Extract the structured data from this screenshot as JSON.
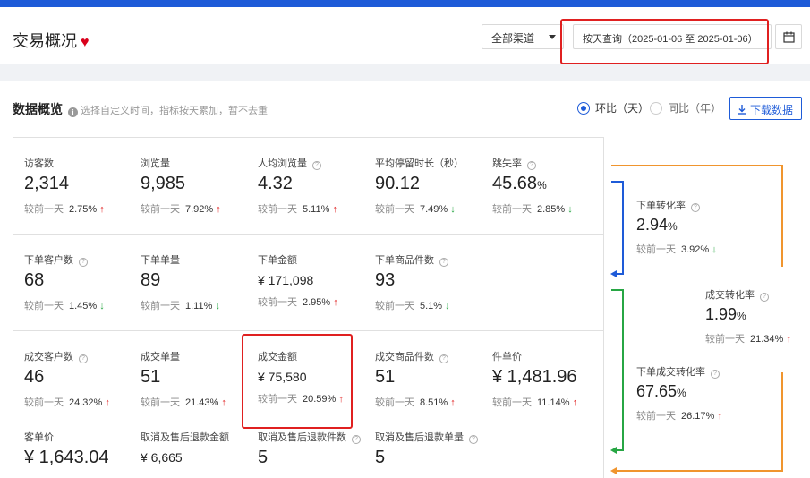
{
  "header": {
    "title": "交易概况",
    "channel": "全部渠道",
    "date_range": "按天查询（2025-01-06 至 2025-01-06）"
  },
  "overview": {
    "title": "数据概览",
    "hint": "选择自定义时间，指标按天累加，暂不去重",
    "radio_day": "环比（天）",
    "radio_year": "同比（年）",
    "download": "下载数据"
  },
  "compare_label": "较前一天",
  "colors": {
    "accent": "#1e5bd8",
    "up": "#e02020",
    "down": "#27a644",
    "orange": "#f0952e",
    "green": "#27a644",
    "blue": "#1e5bd8"
  },
  "row1": [
    {
      "label": "访客数",
      "value": "2,314",
      "unit": "",
      "pct": "2.75%",
      "dir": "up",
      "help": false
    },
    {
      "label": "浏览量",
      "value": "9,985",
      "unit": "",
      "pct": "7.92%",
      "dir": "up",
      "help": false
    },
    {
      "label": "人均浏览量",
      "value": "4.32",
      "unit": "",
      "pct": "5.11%",
      "dir": "up",
      "help": true
    },
    {
      "label": "平均停留时长（秒）",
      "value": "90.12",
      "unit": "",
      "pct": "7.49%",
      "dir": "down",
      "help": false
    },
    {
      "label": "跳失率",
      "value": "45.68",
      "unit": "%",
      "pct": "2.85%",
      "dir": "down",
      "help": true
    }
  ],
  "row2": [
    {
      "label": "下单客户数",
      "value": "68",
      "pct": "1.45%",
      "dir": "down",
      "help": true
    },
    {
      "label": "下单单量",
      "value": "89",
      "pct": "1.11%",
      "dir": "down",
      "help": false
    },
    {
      "label": "下单金额",
      "value": "¥ 171,098",
      "pct": "2.95%",
      "dir": "up",
      "help": false
    },
    {
      "label": "下单商品件数",
      "value": "93",
      "pct": "5.1%",
      "dir": "down",
      "help": true
    }
  ],
  "row3": [
    {
      "label": "成交客户数",
      "value": "46",
      "pct": "24.32%",
      "dir": "up",
      "help": true
    },
    {
      "label": "成交单量",
      "value": "51",
      "pct": "21.43%",
      "dir": "up",
      "help": false
    },
    {
      "label": "成交金额",
      "value": "¥ 75,580",
      "pct": "20.59%",
      "dir": "up",
      "help": false
    },
    {
      "label": "成交商品件数",
      "value": "51",
      "pct": "8.51%",
      "dir": "up",
      "help": true
    },
    {
      "label": "件单价",
      "value": "¥ 1,481.96",
      "pct": "11.14%",
      "dir": "up",
      "help": false
    }
  ],
  "row4": [
    {
      "label": "客单价",
      "value": "¥ 1,643.04",
      "help": false
    },
    {
      "label": "取消及售后退款金额",
      "value": "¥ 6,665",
      "help": false
    },
    {
      "label": "取消及售后退款件数",
      "value": "5",
      "help": true
    },
    {
      "label": "取消及售后退款单量",
      "value": "5",
      "help": true
    }
  ],
  "conversions": [
    {
      "label": "下单转化率",
      "value": "2.94",
      "unit": "%",
      "pct": "3.92%",
      "dir": "down"
    },
    {
      "label": "成交转化率",
      "value": "1.99",
      "unit": "%",
      "pct": "21.34%",
      "dir": "up"
    },
    {
      "label": "下单成交转化率",
      "value": "67.65",
      "unit": "%",
      "pct": "26.17%",
      "dir": "up"
    }
  ]
}
